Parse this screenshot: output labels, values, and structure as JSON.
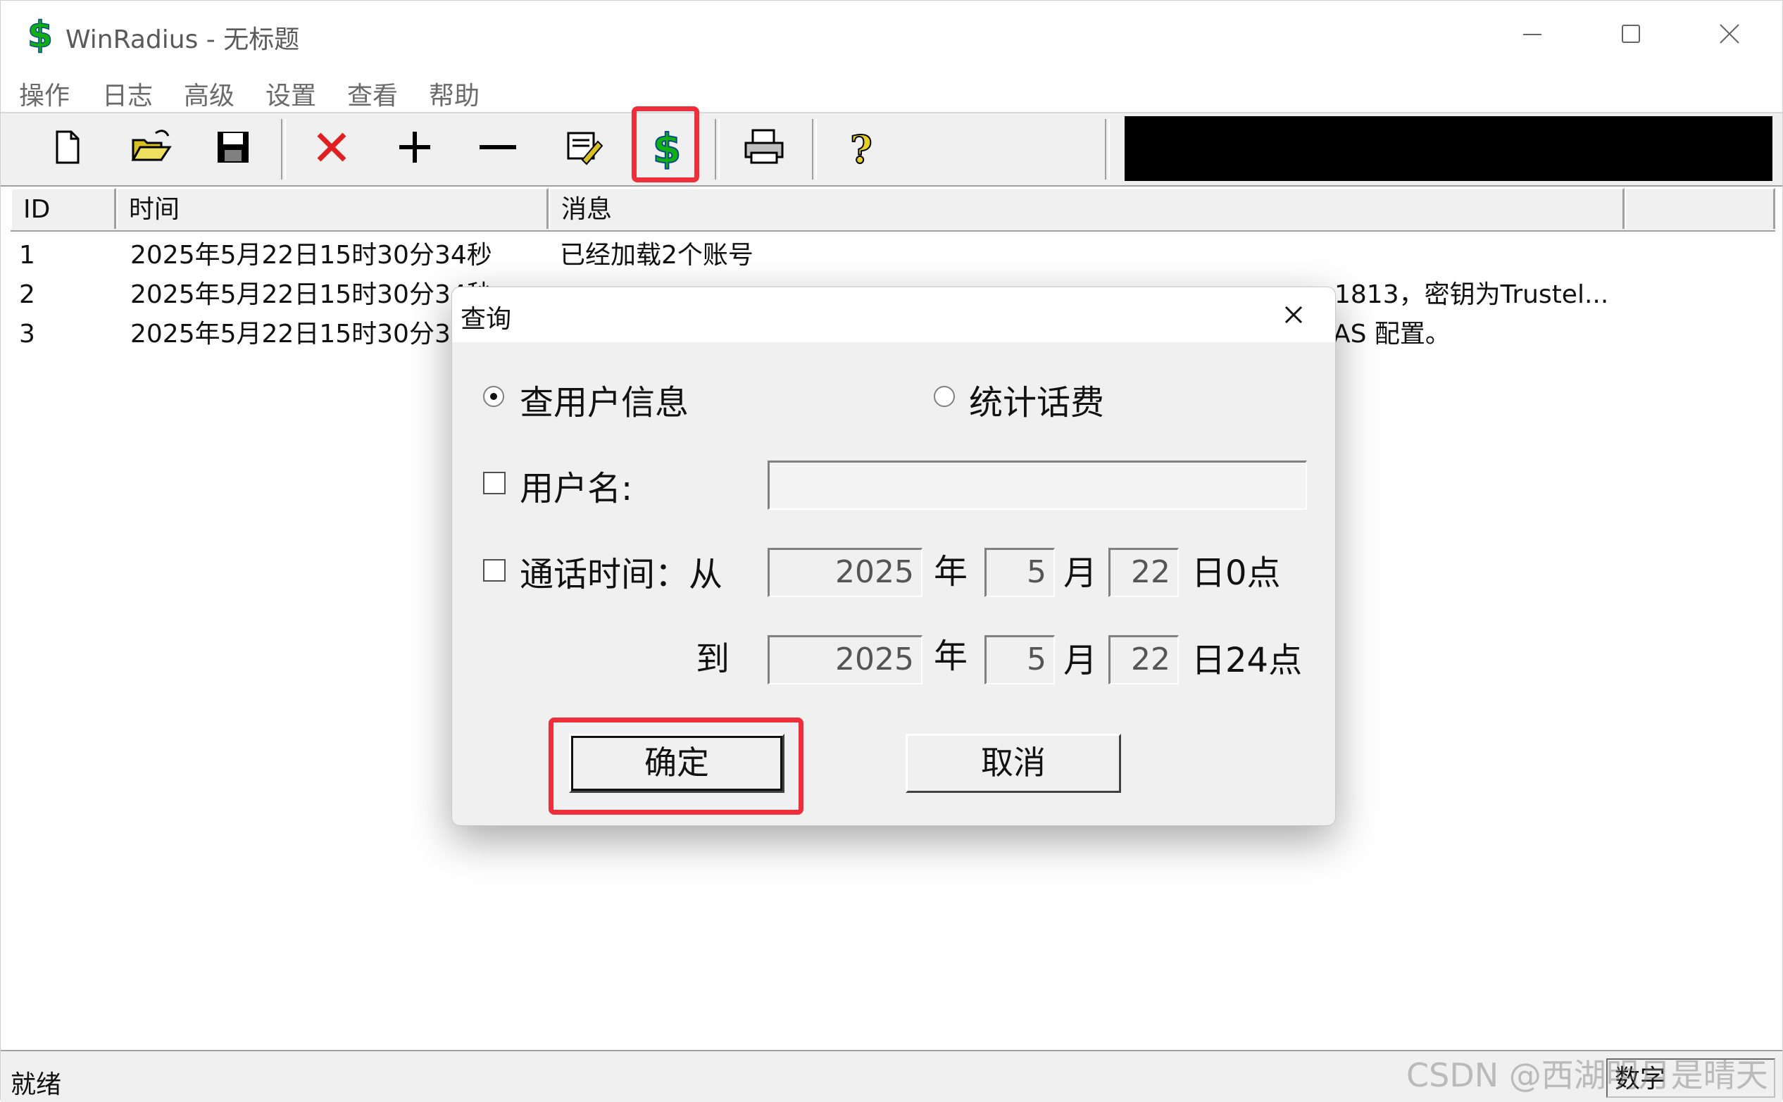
{
  "window": {
    "title": "WinRadius - 无标题"
  },
  "menu": [
    "操作",
    "日志",
    "高级",
    "设置",
    "查看",
    "帮助"
  ],
  "toolbar": {
    "buttons": [
      "new-icon",
      "open-icon",
      "save-icon",
      "delete-icon",
      "add-icon",
      "remove-icon",
      "edit-icon",
      "billing-query-icon",
      "print-icon",
      "help-icon"
    ],
    "highlight_color": "#ee2e3a"
  },
  "list": {
    "columns": [
      "ID",
      "时间",
      "消息"
    ],
    "rows": [
      {
        "id": "1",
        "time": "2025年5月22日15时30分34秒",
        "message": "已经加载2个账号"
      },
      {
        "id": "2",
        "time": "2025年5月22日15时30分34秒",
        "message": "1813，密钥为Trustel..."
      },
      {
        "id": "3",
        "time": "2025年5月22日15时30分34",
        "message": "AS 配置。"
      }
    ]
  },
  "status": {
    "text": "就绪",
    "mode": "数字"
  },
  "watermark": "CSDN @西湖明月是晴天",
  "dialog": {
    "title": "查询",
    "radio_user": "查用户信息",
    "radio_billing": "统计话费",
    "username_label": "用户名:",
    "username_value": "",
    "time_label": "通话时间：从",
    "to_label": "到",
    "from": {
      "year": "2025",
      "month": "5",
      "day": "22",
      "hour_suffix": "日0点"
    },
    "to": {
      "year": "2025",
      "month": "5",
      "day": "22",
      "hour_suffix": "日24点"
    },
    "year_unit": "年",
    "month_unit": "月",
    "ok_label": "确定",
    "cancel_label": "取消"
  }
}
